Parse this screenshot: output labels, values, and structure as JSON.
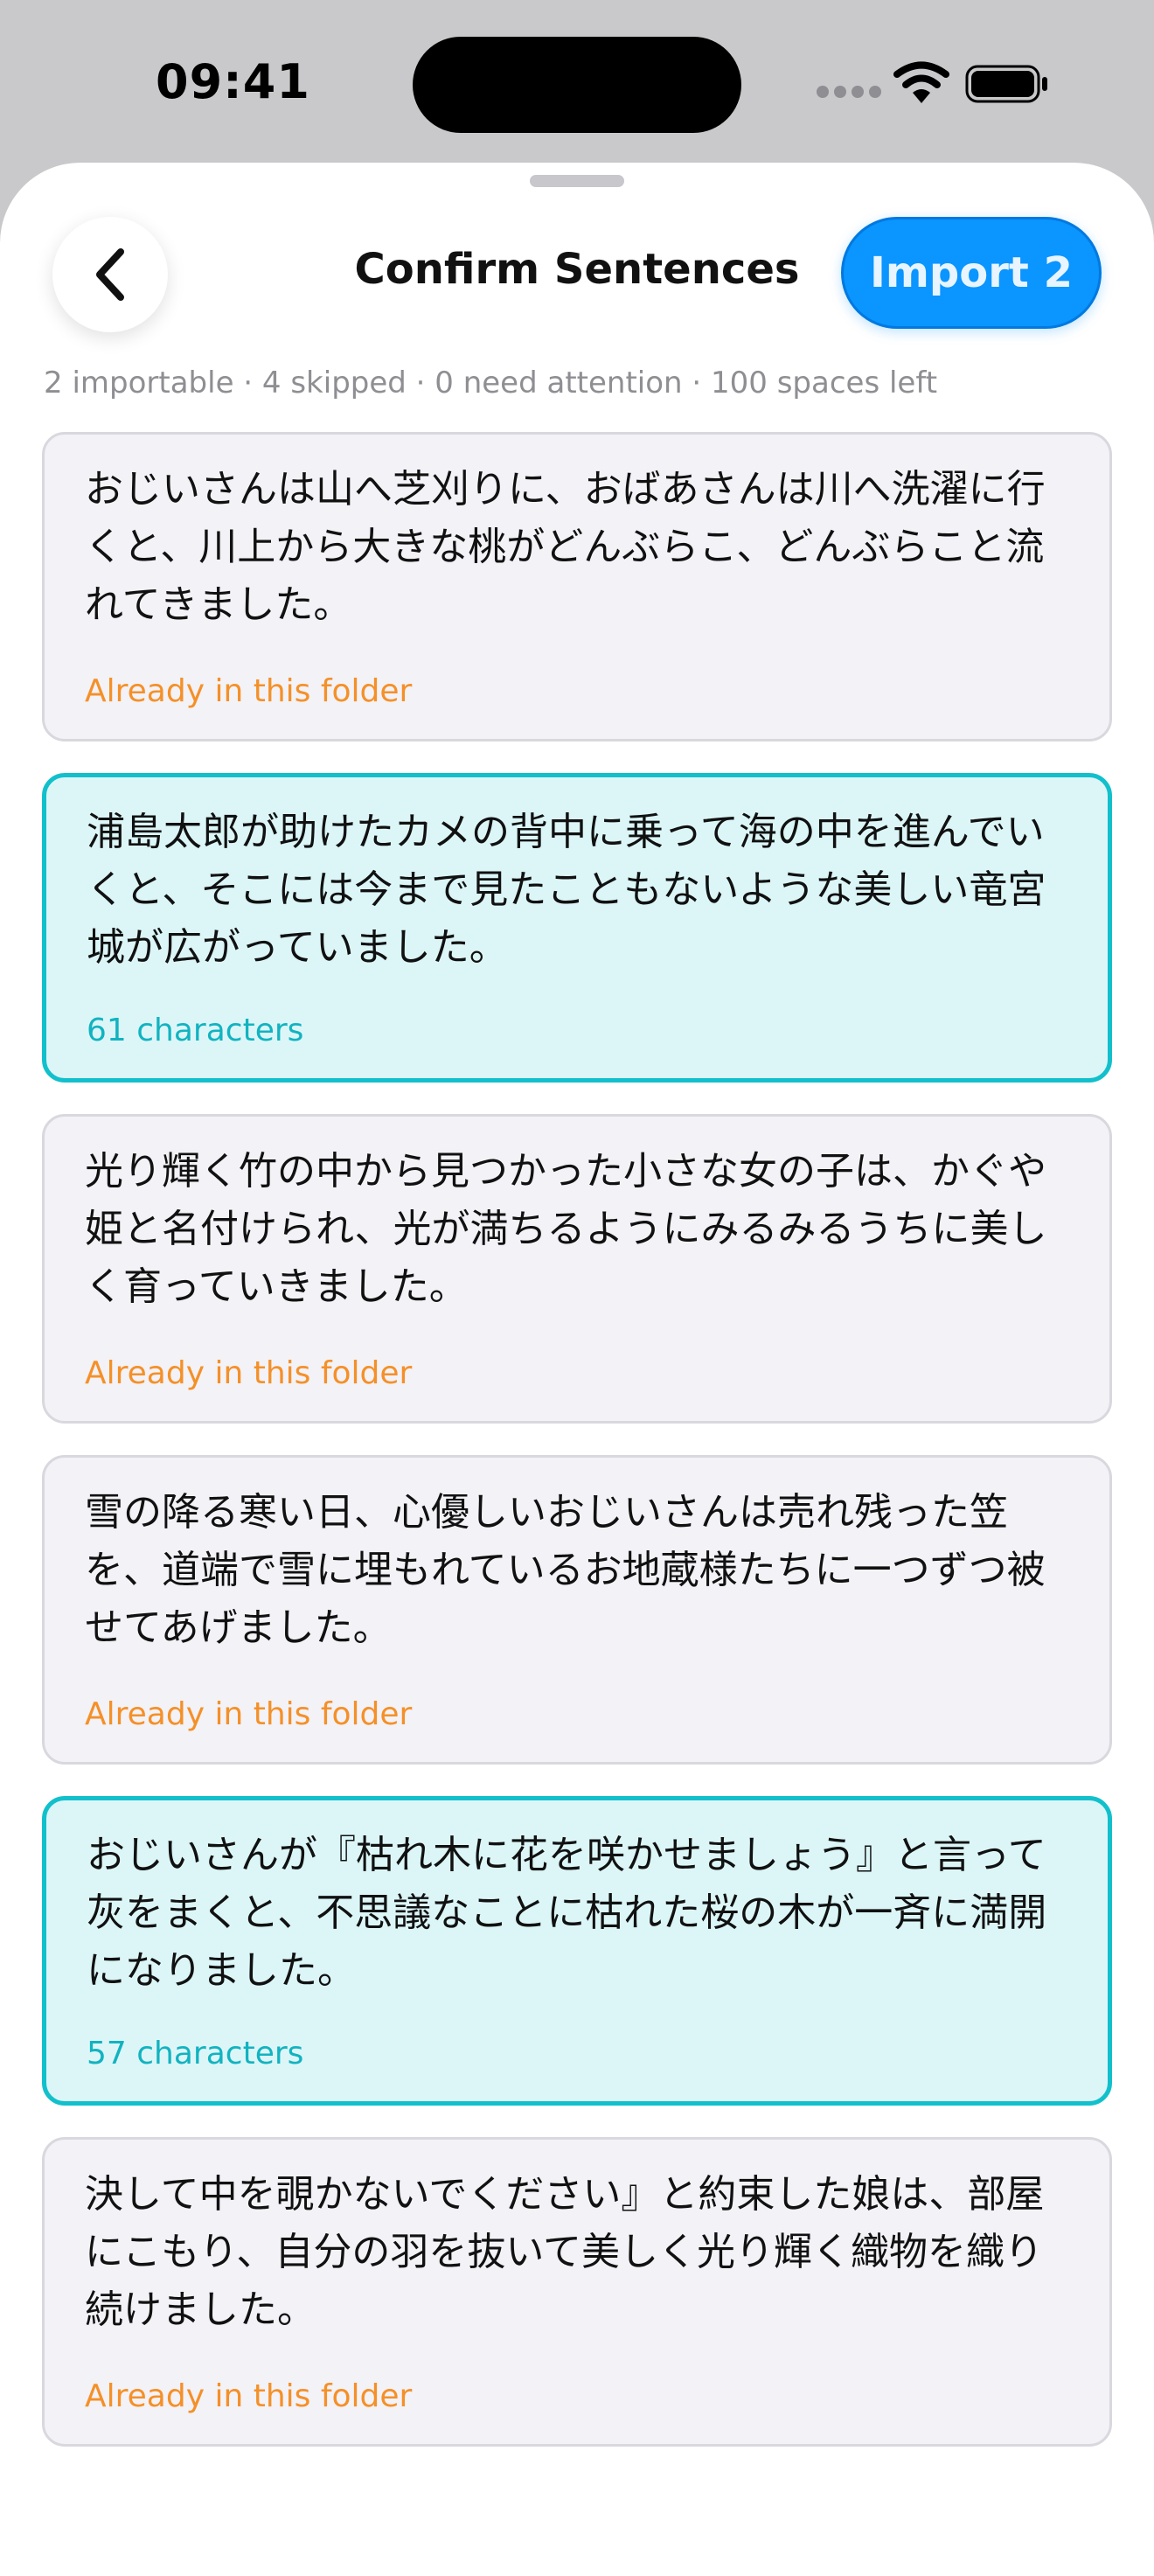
{
  "status": {
    "time": "09:41"
  },
  "header": {
    "title": "Confirm Sentences",
    "import_label": "Import 2"
  },
  "summary": "2 importable · 4 skipped · 0 need attention · 100 spaces left",
  "sentences": [
    {
      "text": "おじいさんは山へ芝刈りに、おばあさんは川へ洗濯に行くと、川上から大きな桃がどんぶらこ、どんぶらこと流れてきました。",
      "note": "Already in this folder",
      "status": "skipped"
    },
    {
      "text": "浦島太郎が助けたカメの背中に乗って海の中を進んでいくと、そこには今まで見たこともないような美しい竜宮城が広がっていました。",
      "note": "61 characters",
      "status": "importable"
    },
    {
      "text": "光り輝く竹の中から見つかった小さな女の子は、かぐや姫と名付けられ、光が満ちるようにみるみるうちに美しく育っていきました。",
      "note": "Already in this folder",
      "status": "skipped"
    },
    {
      "text": "雪の降る寒い日、心優しいおじいさんは売れ残った笠を、道端で雪に埋もれているお地蔵様たちに一つずつ被せてあげました。",
      "note": "Already in this folder",
      "status": "skipped"
    },
    {
      "text": "おじいさんが『枯れ木に花を咲かせましょう』と言って灰をまくと、不思議なことに枯れた桜の木が一斉に満開になりました。",
      "note": "57 characters",
      "status": "importable"
    },
    {
      "text": "決して中を覗かないでください』と約束した娘は、部屋にこもり、自分の羽を抜いて美しく光り輝く織物を織り続けました。",
      "note": "Already in this folder",
      "status": "skipped"
    }
  ],
  "colors": {
    "accent": "#0a95ff",
    "importable_border": "#12c0cc",
    "skipped_note": "#f59028"
  }
}
